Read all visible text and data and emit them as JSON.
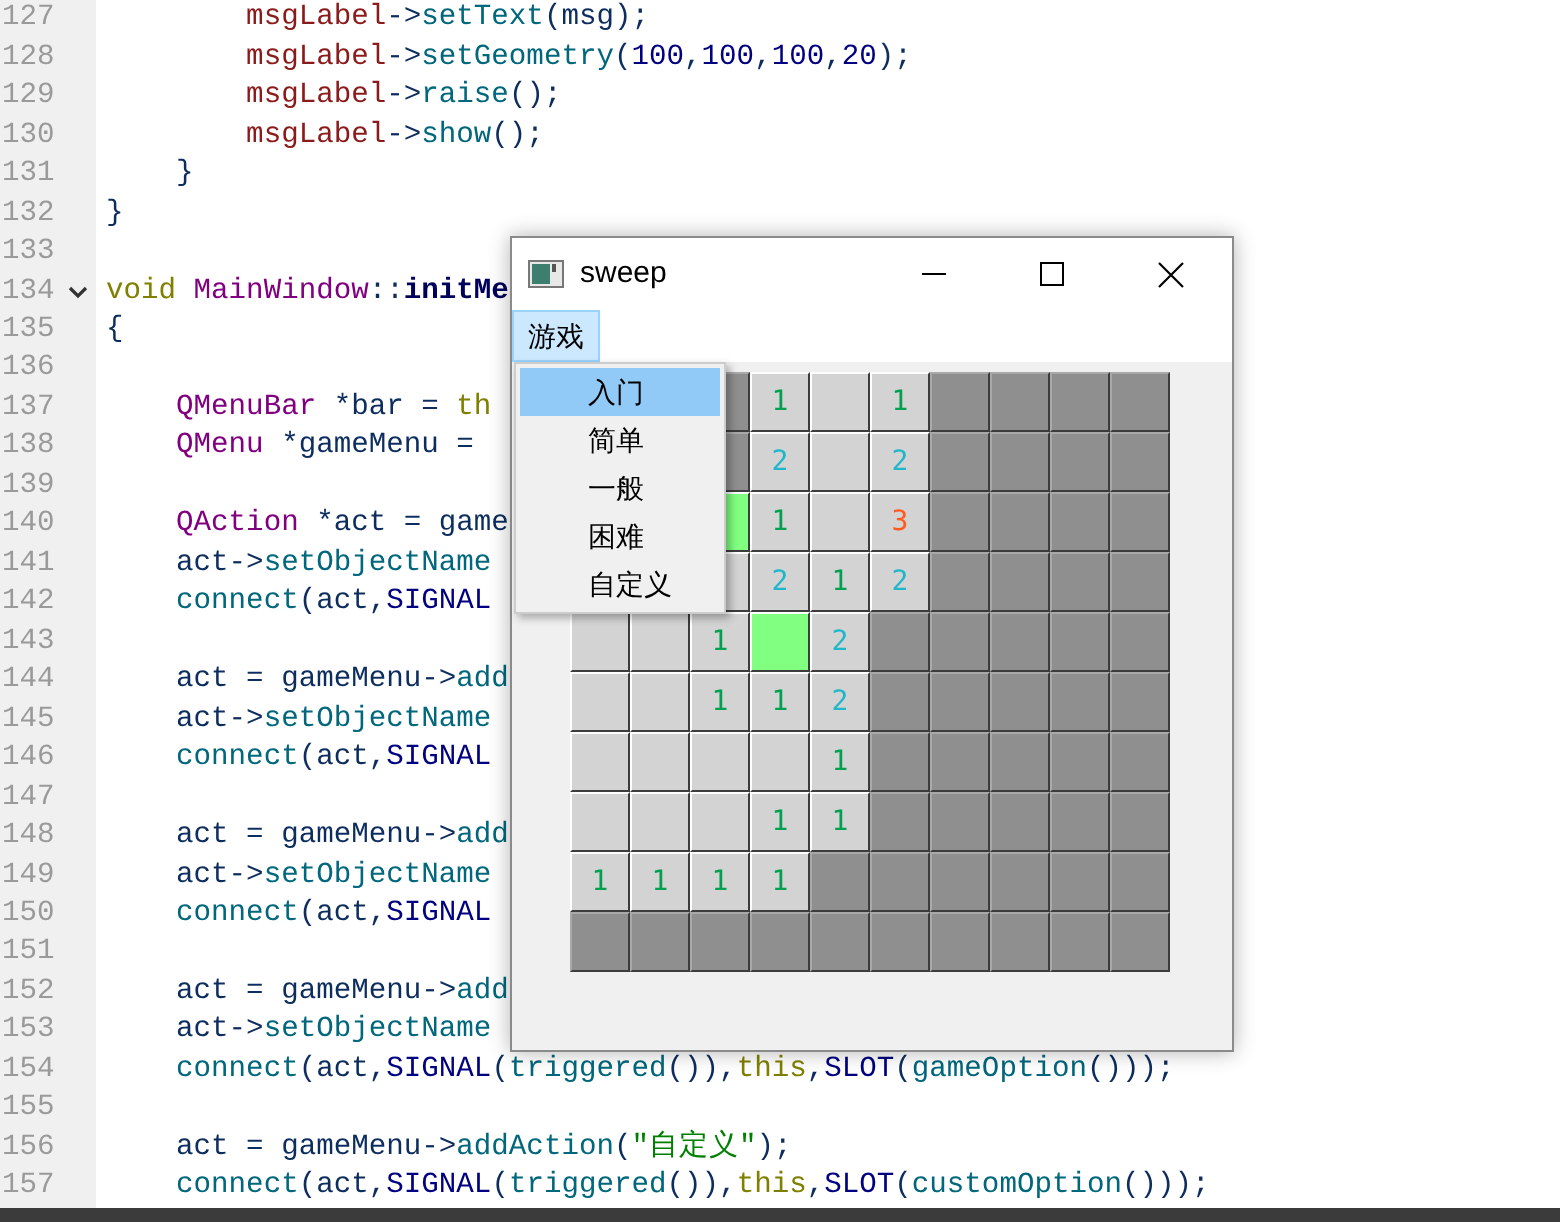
{
  "editor": {
    "lines": [
      {
        "number": "127",
        "tokens": [
          {
            "text": "        msgLabel",
            "kind": "var"
          },
          {
            "text": "->",
            "kind": "plain"
          },
          {
            "text": "setText",
            "kind": "func"
          },
          {
            "text": "(msg);",
            "kind": "plain"
          }
        ]
      },
      {
        "number": "128",
        "tokens": [
          {
            "text": "        msgLabel",
            "kind": "var"
          },
          {
            "text": "->",
            "kind": "plain"
          },
          {
            "text": "setGeometry",
            "kind": "func"
          },
          {
            "text": "(",
            "kind": "plain"
          },
          {
            "text": "100",
            "kind": "number"
          },
          {
            "text": ",",
            "kind": "plain"
          },
          {
            "text": "100",
            "kind": "number"
          },
          {
            "text": ",",
            "kind": "plain"
          },
          {
            "text": "100",
            "kind": "number"
          },
          {
            "text": ",",
            "kind": "plain"
          },
          {
            "text": "20",
            "kind": "number"
          },
          {
            "text": ");",
            "kind": "plain"
          }
        ]
      },
      {
        "number": "129",
        "tokens": [
          {
            "text": "        msgLabel",
            "kind": "var"
          },
          {
            "text": "->",
            "kind": "plain"
          },
          {
            "text": "raise",
            "kind": "func"
          },
          {
            "text": "();",
            "kind": "plain"
          }
        ]
      },
      {
        "number": "130",
        "tokens": [
          {
            "text": "        msgLabel",
            "kind": "var"
          },
          {
            "text": "->",
            "kind": "plain"
          },
          {
            "text": "show",
            "kind": "func"
          },
          {
            "text": "();",
            "kind": "plain"
          }
        ]
      },
      {
        "number": "131",
        "tokens": [
          {
            "text": "    }",
            "kind": "plain"
          }
        ]
      },
      {
        "number": "132",
        "tokens": [
          {
            "text": "}",
            "kind": "plain"
          }
        ]
      },
      {
        "number": "133"
      },
      {
        "number": "134",
        "expanded": true,
        "tokens": [
          {
            "text": "void",
            "kind": "keyword"
          },
          {
            "text": " MainWindow",
            "kind": "type"
          },
          {
            "text": "::",
            "kind": "plain"
          },
          {
            "text": "initMe",
            "kind": "decl"
          }
        ]
      },
      {
        "number": "135",
        "tokens": [
          {
            "text": "{",
            "kind": "plain"
          }
        ]
      },
      {
        "number": "136"
      },
      {
        "number": "137",
        "tokens": [
          {
            "text": "    QMenuBar",
            "kind": "type"
          },
          {
            "text": " *bar = ",
            "kind": "plain"
          },
          {
            "text": "th",
            "kind": "keyword"
          }
        ]
      },
      {
        "number": "138",
        "tokens": [
          {
            "text": "    QMenu",
            "kind": "type"
          },
          {
            "text": " *gameMenu =",
            "kind": "plain"
          }
        ]
      },
      {
        "number": "139"
      },
      {
        "number": "140",
        "tokens": [
          {
            "text": "    QAction",
            "kind": "type"
          },
          {
            "text": " *act = game",
            "kind": "plain"
          }
        ]
      },
      {
        "number": "141",
        "tokens": [
          {
            "text": "    act->",
            "kind": "plain"
          },
          {
            "text": "setObjectName",
            "kind": "func"
          }
        ]
      },
      {
        "number": "142",
        "tokens": [
          {
            "text": "    connect",
            "kind": "func"
          },
          {
            "text": "(act,",
            "kind": "plain"
          },
          {
            "text": "SIGNAL",
            "kind": "macro"
          }
        ]
      },
      {
        "number": "143"
      },
      {
        "number": "144",
        "tokens": [
          {
            "text": "    act = gameMenu->",
            "kind": "plain"
          },
          {
            "text": "add",
            "kind": "func"
          }
        ]
      },
      {
        "number": "145",
        "tokens": [
          {
            "text": "    act->",
            "kind": "plain"
          },
          {
            "text": "setObjectName",
            "kind": "func"
          }
        ]
      },
      {
        "number": "146",
        "tokens": [
          {
            "text": "    connect",
            "kind": "func"
          },
          {
            "text": "(act,",
            "kind": "plain"
          },
          {
            "text": "SIGNAL",
            "kind": "macro"
          }
        ]
      },
      {
        "number": "147"
      },
      {
        "number": "148",
        "tokens": [
          {
            "text": "    act = gameMenu->",
            "kind": "plain"
          },
          {
            "text": "add",
            "kind": "func"
          }
        ]
      },
      {
        "number": "149",
        "tokens": [
          {
            "text": "    act->",
            "kind": "plain"
          },
          {
            "text": "setObjectName",
            "kind": "func"
          }
        ]
      },
      {
        "number": "150",
        "tokens": [
          {
            "text": "    connect",
            "kind": "func"
          },
          {
            "text": "(act,",
            "kind": "plain"
          },
          {
            "text": "SIGNAL",
            "kind": "macro"
          }
        ]
      },
      {
        "number": "151"
      },
      {
        "number": "152",
        "tokens": [
          {
            "text": "    act = gameMenu->",
            "kind": "plain"
          },
          {
            "text": "add",
            "kind": "func"
          }
        ]
      },
      {
        "number": "153",
        "tokens": [
          {
            "text": "    act->",
            "kind": "plain"
          },
          {
            "text": "setObjectName",
            "kind": "func"
          }
        ]
      },
      {
        "number": "154",
        "tokens": [
          {
            "text": "    connect",
            "kind": "func"
          },
          {
            "text": "(act,",
            "kind": "plain"
          },
          {
            "text": "SIGNAL",
            "kind": "macro"
          },
          {
            "text": "(",
            "kind": "plain"
          },
          {
            "text": "triggered",
            "kind": "func"
          },
          {
            "text": "()),",
            "kind": "plain"
          },
          {
            "text": "this",
            "kind": "keyword"
          },
          {
            "text": ",",
            "kind": "plain"
          },
          {
            "text": "SLOT",
            "kind": "macro"
          },
          {
            "text": "(",
            "kind": "plain"
          },
          {
            "text": "gameOption",
            "kind": "func"
          },
          {
            "text": "()));",
            "kind": "plain"
          }
        ]
      },
      {
        "number": "155"
      },
      {
        "number": "156",
        "tokens": [
          {
            "text": "    act = gameMenu->",
            "kind": "plain"
          },
          {
            "text": "addAction",
            "kind": "func"
          },
          {
            "text": "(",
            "kind": "plain"
          },
          {
            "text": "\"自定义\"",
            "kind": "string"
          },
          {
            "text": ");",
            "kind": "plain"
          }
        ]
      },
      {
        "number": "157",
        "tokens": [
          {
            "text": "    connect",
            "kind": "func"
          },
          {
            "text": "(act,",
            "kind": "plain"
          },
          {
            "text": "SIGNAL",
            "kind": "macro"
          },
          {
            "text": "(",
            "kind": "plain"
          },
          {
            "text": "triggered",
            "kind": "func"
          },
          {
            "text": "()),",
            "kind": "plain"
          },
          {
            "text": "this",
            "kind": "keyword"
          },
          {
            "text": ",",
            "kind": "plain"
          },
          {
            "text": "SLOT",
            "kind": "macro"
          },
          {
            "text": "(",
            "kind": "plain"
          },
          {
            "text": "customOption",
            "kind": "func"
          },
          {
            "text": "()));",
            "kind": "plain"
          }
        ]
      }
    ]
  },
  "window": {
    "title": "sweep",
    "menu_bar": [
      {
        "label": "游戏",
        "selected": true
      }
    ],
    "menu": [
      {
        "label": "入门",
        "selected": true
      },
      {
        "label": "简单",
        "selected": false
      },
      {
        "label": "一般",
        "selected": false
      },
      {
        "label": "困难",
        "selected": false
      },
      {
        "label": "自定义",
        "selected": false
      }
    ],
    "grid": [
      [
        {
          "kind": "closed"
        },
        {
          "kind": "open",
          "text": "1",
          "color": "#00a050"
        },
        {
          "kind": "open"
        },
        {
          "kind": "open",
          "text": "1",
          "color": "#00a050"
        },
        {
          "kind": "closed"
        },
        {
          "kind": "closed"
        },
        {
          "kind": "closed"
        },
        {
          "kind": "closed"
        }
      ],
      [
        {
          "kind": "closed"
        },
        {
          "kind": "open",
          "text": "2",
          "color": "#20b8c8"
        },
        {
          "kind": "open"
        },
        {
          "kind": "open",
          "text": "2",
          "color": "#20b8c8"
        },
        {
          "kind": "closed"
        },
        {
          "kind": "closed"
        },
        {
          "kind": "closed"
        },
        {
          "kind": "closed"
        }
      ],
      [
        {
          "kind": "marked"
        },
        {
          "kind": "open",
          "text": "1",
          "color": "#00a050"
        },
        {
          "kind": "open"
        },
        {
          "kind": "open",
          "text": "3",
          "color": "#ff5a1f"
        },
        {
          "kind": "closed"
        },
        {
          "kind": "closed"
        },
        {
          "kind": "closed"
        },
        {
          "kind": "closed"
        }
      ],
      [
        {
          "kind": "open"
        },
        {
          "kind": "open",
          "text": "2",
          "color": "#20b8c8"
        },
        {
          "kind": "open",
          "text": "1",
          "color": "#00a050"
        },
        {
          "kind": "open",
          "text": "2",
          "color": "#20b8c8"
        },
        {
          "kind": "closed"
        },
        {
          "kind": "closed"
        },
        {
          "kind": "closed"
        },
        {
          "kind": "closed"
        }
      ],
      [
        {
          "kind": "open"
        },
        {
          "kind": "open"
        },
        {
          "kind": "open",
          "text": "1",
          "color": "#00a050"
        },
        {
          "kind": "marked"
        },
        {
          "kind": "open",
          "text": "2",
          "color": "#20b8c8"
        },
        {
          "kind": "closed"
        },
        {
          "kind": "closed"
        },
        {
          "kind": "closed"
        },
        {
          "kind": "closed"
        },
        {
          "kind": "closed"
        }
      ],
      [
        {
          "kind": "open"
        },
        {
          "kind": "open"
        },
        {
          "kind": "open",
          "text": "1",
          "color": "#00a050"
        },
        {
          "kind": "open",
          "text": "1",
          "color": "#00a050"
        },
        {
          "kind": "open",
          "text": "2",
          "color": "#20b8c8"
        },
        {
          "kind": "closed"
        },
        {
          "kind": "closed"
        },
        {
          "kind": "closed"
        },
        {
          "kind": "closed"
        },
        {
          "kind": "closed"
        }
      ],
      [
        {
          "kind": "open"
        },
        {
          "kind": "open"
        },
        {
          "kind": "open"
        },
        {
          "kind": "open"
        },
        {
          "kind": "open",
          "text": "1",
          "color": "#00a050"
        },
        {
          "kind": "closed"
        },
        {
          "kind": "closed"
        },
        {
          "kind": "closed"
        },
        {
          "kind": "closed"
        },
        {
          "kind": "closed"
        }
      ],
      [
        {
          "kind": "open"
        },
        {
          "kind": "open"
        },
        {
          "kind": "open"
        },
        {
          "kind": "open",
          "text": "1",
          "color": "#00a050"
        },
        {
          "kind": "open",
          "text": "1",
          "color": "#00a050"
        },
        {
          "kind": "closed"
        },
        {
          "kind": "closed"
        },
        {
          "kind": "closed"
        },
        {
          "kind": "closed"
        },
        {
          "kind": "closed"
        }
      ],
      [
        {
          "kind": "open",
          "text": "1",
          "color": "#00a050"
        },
        {
          "kind": "open",
          "text": "1",
          "color": "#00a050"
        },
        {
          "kind": "open",
          "text": "1",
          "color": "#00a050"
        },
        {
          "kind": "open",
          "text": "1",
          "color": "#00a050"
        },
        {
          "kind": "closed"
        },
        {
          "kind": "closed"
        },
        {
          "kind": "closed"
        },
        {
          "kind": "closed"
        },
        {
          "kind": "closed"
        },
        {
          "kind": "closed"
        }
      ],
      [
        {
          "kind": "closed"
        },
        {
          "kind": "closed"
        },
        {
          "kind": "closed"
        },
        {
          "kind": "closed"
        },
        {
          "kind": "closed"
        },
        {
          "kind": "closed"
        },
        {
          "kind": "closed"
        },
        {
          "kind": "closed"
        },
        {
          "kind": "closed"
        },
        {
          "kind": "closed"
        }
      ]
    ]
  }
}
